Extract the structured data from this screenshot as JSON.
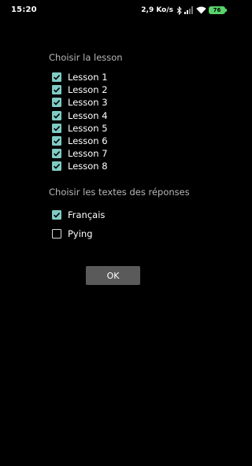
{
  "status_bar": {
    "time": "15:20",
    "net_speed": "2,9 Ko/s",
    "icons": [
      "bluetooth-icon",
      "signal-icon",
      "wifi-icon",
      "battery-icon"
    ],
    "battery": "76"
  },
  "lesson_section": {
    "title": "Choisir la lesson",
    "items": [
      {
        "label": "Lesson 1",
        "checked": true
      },
      {
        "label": "Lesson 2",
        "checked": true
      },
      {
        "label": "Lesson 3",
        "checked": true
      },
      {
        "label": "Lesson 4",
        "checked": true
      },
      {
        "label": "Lesson 5",
        "checked": true
      },
      {
        "label": "Lesson 6",
        "checked": true
      },
      {
        "label": "Lesson 7",
        "checked": true
      },
      {
        "label": "Lesson 8",
        "checked": true
      }
    ]
  },
  "answers_section": {
    "title": "Choisir les textes des réponses",
    "options": [
      {
        "label": "Français",
        "checked": true
      },
      {
        "label": "Pying",
        "checked": false
      }
    ]
  },
  "ok_button": {
    "label": "OK"
  },
  "colors": {
    "background": "#000000",
    "checkbox_checked": "#80cbc4",
    "battery": "#59d36a",
    "button": "#5a5a5a",
    "section_title": "#b8b8b8"
  }
}
